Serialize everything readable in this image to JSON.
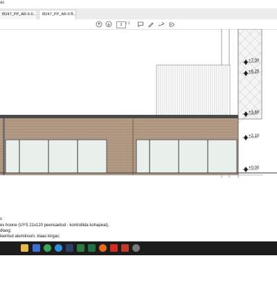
{
  "window": {
    "title": "ac"
  },
  "tabs": [
    {
      "label": "f8247_PP_AR-6-0...",
      "active": false
    },
    {
      "label": "f8247_PP_AR-6-3...",
      "active": true
    }
  ],
  "toolbar": {
    "page_current": "1",
    "page_total": "/ 1",
    "icons": [
      "arrow-up-icon",
      "arrow-down-icon",
      "comment-icon",
      "pen-icon",
      "sign-icon",
      "share-icon"
    ]
  },
  "drawing": {
    "elevation_labels": [
      "+7.00",
      "+6.25",
      "+3.60",
      "+2.10",
      "+0.00"
    ]
  },
  "notes": [
    "s",
    "ev hoone (UYS 21x120 peensaetud - kontrollida kohapeal),",
    "dlaog;",
    "leeritud alumiinium, klaas kirgas;"
  ],
  "taskbar": {
    "icons": [
      "folder-icon",
      "mail-icon",
      "chrome-icon",
      "edge-icon",
      "id-icon",
      "d-icon",
      "excel-icon",
      "firefox-icon",
      "pdf-icon",
      "red-app-icon",
      "settings-icon"
    ]
  },
  "colors": {
    "wood": "#b39a84",
    "glass": "#e9efea",
    "taskbar": "#1c1c1c"
  }
}
